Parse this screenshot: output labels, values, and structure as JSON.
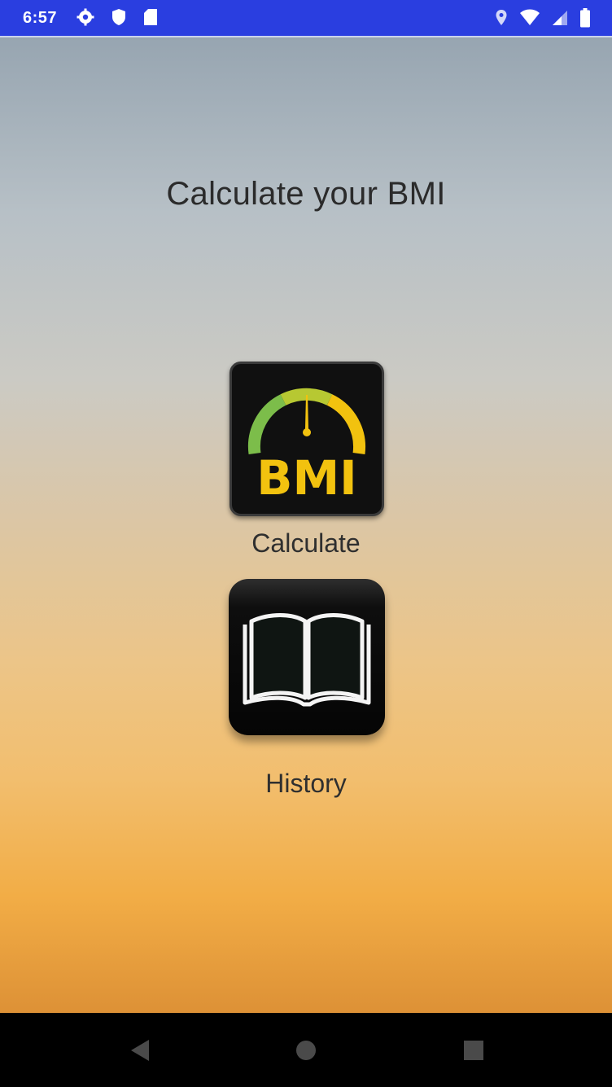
{
  "status_bar": {
    "time": "6:57",
    "left_icons": [
      "settings-icon",
      "shield-icon",
      "sd-card-icon"
    ],
    "right_icons": [
      "location-icon",
      "wifi-icon",
      "signal-icon",
      "battery-icon"
    ]
  },
  "main": {
    "title": "Calculate your BMI",
    "tiles": [
      {
        "id": "calculate",
        "label": "Calculate",
        "icon": "bmi-gauge-icon",
        "icon_text": "BMI"
      },
      {
        "id": "history",
        "label": "History",
        "icon": "open-book-icon"
      }
    ]
  },
  "colors": {
    "status_bar": "#2a3ee0",
    "gradient_top": "#97a5b1",
    "gradient_bottom": "#dd9136",
    "bmi_yellow": "#f2c20f",
    "gauge_green": "#7cbd4a"
  },
  "nav_bar": {
    "buttons": [
      "back-icon",
      "home-icon",
      "recents-icon"
    ]
  }
}
